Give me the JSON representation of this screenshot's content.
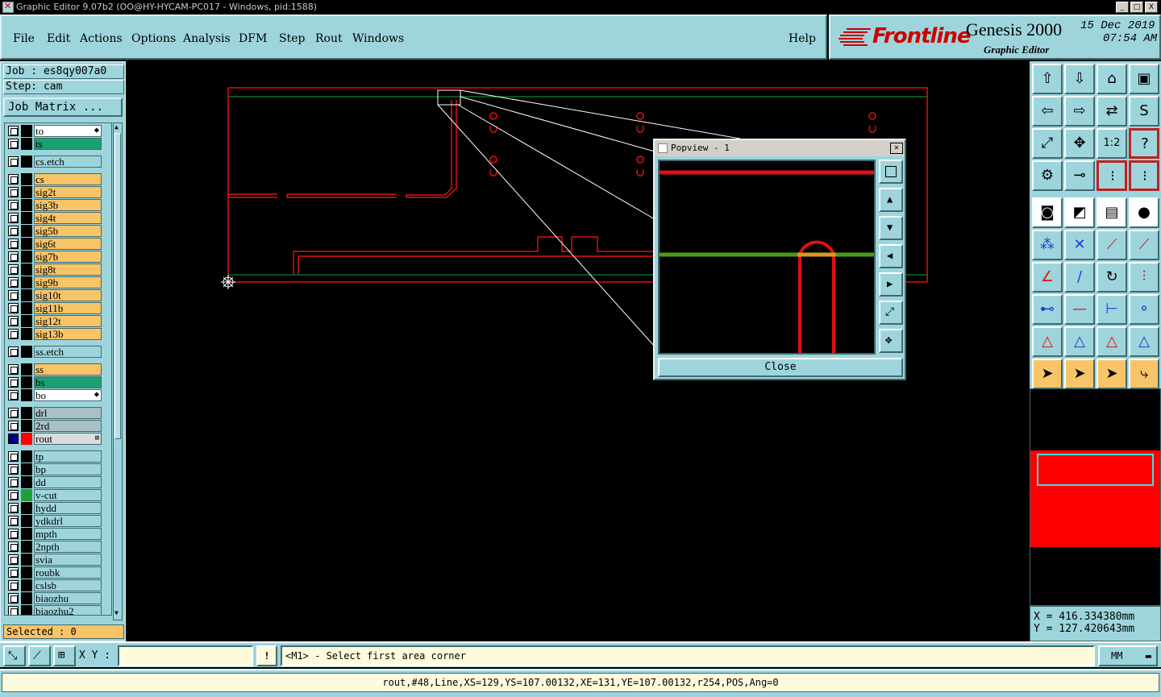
{
  "window": {
    "title": "Graphic Editor 9.07b2 (OO@HY-HYCAM-PC017 - Windows, pid:1588)",
    "buttons": [
      "_",
      "□",
      "X"
    ]
  },
  "menu": [
    "File",
    "Edit",
    "Actions",
    "Options",
    "Analysis",
    "DFM",
    "Step",
    "Rout",
    "Windows"
  ],
  "help": "Help",
  "brand": {
    "logo": "Frontline",
    "product": "Genesis 2000",
    "subtitle": "Graphic Editor",
    "date": "15 Dec 2019",
    "time": "07:54 AM"
  },
  "job": {
    "job_label": "Job : es8qy007a0",
    "step_label": "Step: cam",
    "matrix_button": "Job Matrix ..."
  },
  "layers": [
    {
      "name": "to",
      "color": "#ffffff",
      "swatch": "",
      "mark": "⬥"
    },
    {
      "name": "ts",
      "color": "#1aa172",
      "swatch": ""
    },
    {
      "name": "cs.etch",
      "color": "#9ed5dc",
      "swatch": "",
      "gap": true
    },
    {
      "name": "cs",
      "color": "#f7c468",
      "swatch": "",
      "gap": true
    },
    {
      "name": "sig2t",
      "color": "#f7c468",
      "swatch": ""
    },
    {
      "name": "sig3b",
      "color": "#f7c468",
      "swatch": ""
    },
    {
      "name": "sig4t",
      "color": "#f7c468",
      "swatch": ""
    },
    {
      "name": "sig5b",
      "color": "#f7c468",
      "swatch": ""
    },
    {
      "name": "sig6t",
      "color": "#f7c468",
      "swatch": ""
    },
    {
      "name": "sig7b",
      "color": "#f7c468",
      "swatch": ""
    },
    {
      "name": "sig8t",
      "color": "#f7c468",
      "swatch": ""
    },
    {
      "name": "sig9b",
      "color": "#f7c468",
      "swatch": ""
    },
    {
      "name": "sig10t",
      "color": "#f7c468",
      "swatch": ""
    },
    {
      "name": "sig11b",
      "color": "#f7c468",
      "swatch": ""
    },
    {
      "name": "sig12t",
      "color": "#f7c468",
      "swatch": ""
    },
    {
      "name": "sig13b",
      "color": "#f7c468",
      "swatch": ""
    },
    {
      "name": "ss.etch",
      "color": "#9ed5dc",
      "swatch": "",
      "gap": true
    },
    {
      "name": "ss",
      "color": "#f7c468",
      "swatch": "",
      "gap": true
    },
    {
      "name": "bs",
      "color": "#1aa172",
      "swatch": ""
    },
    {
      "name": "bo",
      "color": "#ffffff",
      "swatch": "",
      "mark": "⬥"
    },
    {
      "name": "drl",
      "color": "#a9c0c6",
      "swatch": "",
      "gap": true
    },
    {
      "name": "2rd",
      "color": "#a9c0c6",
      "swatch": ""
    },
    {
      "name": "rout",
      "color": "#dcdcdc",
      "swatch": "#ff0000",
      "active": true,
      "mark": "⊞"
    },
    {
      "name": "tp",
      "color": "#9ed5dc",
      "swatch": "",
      "gap": true
    },
    {
      "name": "bp",
      "color": "#9ed5dc",
      "swatch": ""
    },
    {
      "name": "dd",
      "color": "#9ed5dc",
      "swatch": ""
    },
    {
      "name": "v-cut",
      "color": "#9ed5dc",
      "swatch": "#1aa13a"
    },
    {
      "name": "hydd",
      "color": "#9ed5dc",
      "swatch": ""
    },
    {
      "name": "ydkdrl",
      "color": "#9ed5dc",
      "swatch": ""
    },
    {
      "name": "mpth",
      "color": "#9ed5dc",
      "swatch": ""
    },
    {
      "name": "2npth",
      "color": "#9ed5dc",
      "swatch": ""
    },
    {
      "name": "svia",
      "color": "#9ed5dc",
      "swatch": ""
    },
    {
      "name": "roubk",
      "color": "#9ed5dc",
      "swatch": ""
    },
    {
      "name": "cslsb",
      "color": "#9ed5dc",
      "swatch": ""
    },
    {
      "name": "biaozhu",
      "color": "#9ed5dc",
      "swatch": ""
    },
    {
      "name": "biaozhu2",
      "color": "#9ed5dc",
      "swatch": ""
    }
  ],
  "selected": "Selected : 0",
  "popview": {
    "title": "Popview - 1",
    "close_button": "Close"
  },
  "coords": {
    "x": "X  =  416.334380mm",
    "y": "Y  =  127.420643mm"
  },
  "bottom": {
    "xy_label": "X Y :",
    "xy_value": "",
    "bang": "!",
    "prompt": "<M1> - Select first area corner",
    "units": "MM"
  },
  "status": "rout,#48,Line,XS=129,YS=107.00132,XE=131,YE=107.00132,r254,POS,Ang=0",
  "toolbar_icons": [
    "open-job-icon",
    "save-job-icon",
    "home-icon",
    "window-icon",
    "pan-left-icon",
    "pan-right-icon",
    "pan-swap-icon",
    "redraw-icon",
    "zoom-fit-icon",
    "zoom-center-icon",
    "zoom-1to2-icon",
    "help-icon",
    "measure-icon",
    "snap-icon",
    "layer-features-icon",
    "layer-compare-icon",
    "pad-icon",
    "corner-icon",
    "ruler-icon",
    "pad-round-icon",
    "connect-icon",
    "cross-icon",
    "line-point-icon",
    "line-point2-icon",
    "angle-icon",
    "diag-line-icon",
    "arc-icon",
    "rout-icon",
    "select-icon",
    "hline-icon",
    "gap-icon",
    "move-icon",
    "triangle-icon",
    "triangle2-icon",
    "triangle3-icon",
    "triangle4-icon",
    "pointer-icon",
    "pointer-box-icon",
    "pointer-circle-icon",
    "pointer-chain-icon"
  ]
}
